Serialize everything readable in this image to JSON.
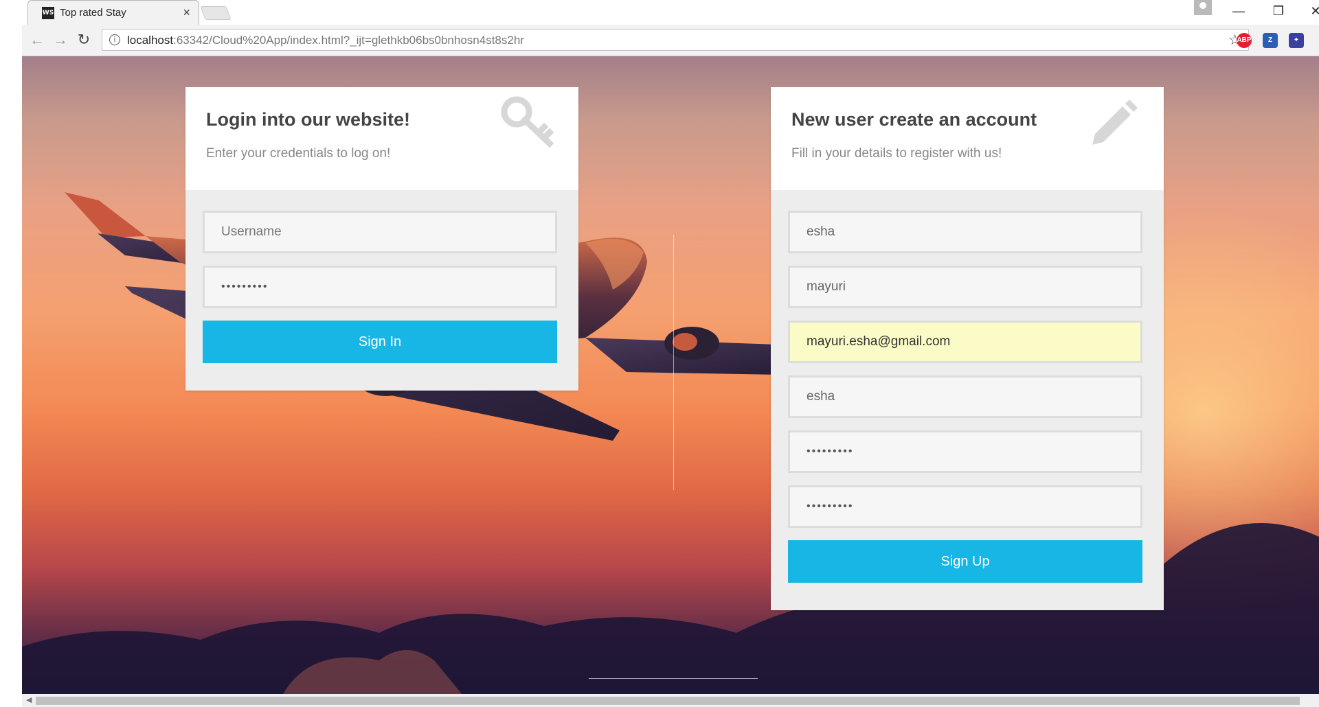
{
  "browser": {
    "tab_title": "Top rated Stay",
    "tab_favicon": "WS",
    "tab_close": "×",
    "url_host": "localhost",
    "url_rest": ":63342/Cloud%20App/index.html?_ijt=glethkb06bs0bnhosn4st8s2hr",
    "star": "☆",
    "back": "←",
    "forward": "→",
    "reload": "↻",
    "minimize": "—",
    "restore": "❐",
    "close": "✕",
    "extensions": [
      {
        "name": "adblock-plus-icon",
        "label": "ABP",
        "color": "#e0202e"
      },
      {
        "name": "zotero-icon",
        "label": "Z",
        "color": "#2b5fb6"
      },
      {
        "name": "extension-icon",
        "label": "✦",
        "color": "#3b3f9e"
      }
    ]
  },
  "login": {
    "title": "Login into our website!",
    "subtitle": "Enter your credentials to log on!",
    "icon": "key-icon",
    "username_placeholder": "Username",
    "password_value": "•••••••••",
    "button": "Sign In"
  },
  "register": {
    "title": "New user create an account",
    "subtitle": "Fill in your details to register with us!",
    "icon": "pencil-icon",
    "first_name": "esha",
    "last_name": "mayuri",
    "email": "mayuri.esha@gmail.com",
    "username": "esha",
    "password": "•••••••••",
    "confirm_password": "•••••••••",
    "button": "Sign Up"
  },
  "colors": {
    "accent": "#18b6e4",
    "autofill": "#fafbc6"
  }
}
